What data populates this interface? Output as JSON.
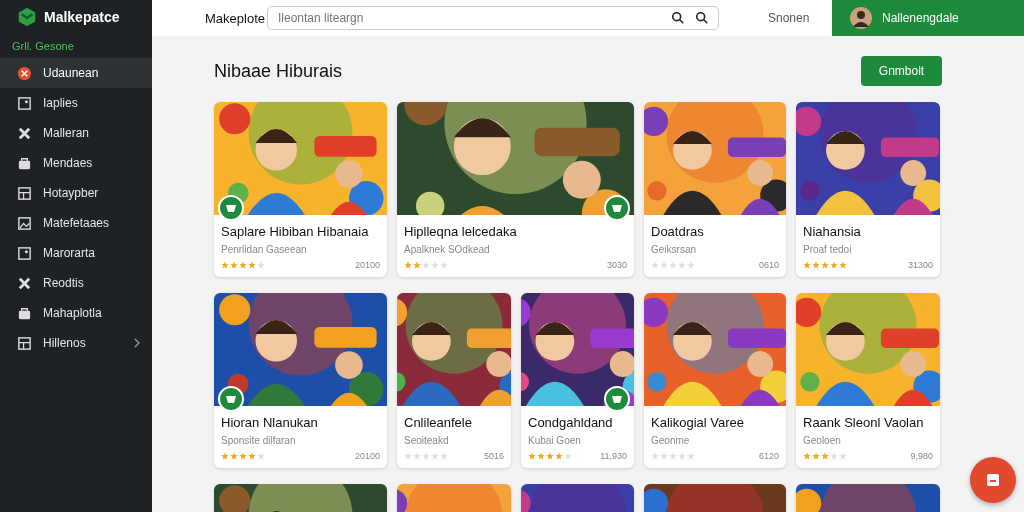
{
  "sidebar": {
    "logo": "Malkepatce",
    "section": "Grll. Gesone",
    "items": [
      {
        "label": "Udaunean",
        "selected": true,
        "has_submenu": false
      },
      {
        "label": "Iaplies",
        "selected": false,
        "has_submenu": false
      },
      {
        "label": "Malleran",
        "selected": false,
        "has_submenu": false
      },
      {
        "label": "Mendaes",
        "selected": false,
        "has_submenu": false
      },
      {
        "label": "Hotaypber",
        "selected": false,
        "has_submenu": false
      },
      {
        "label": "Matefetaaes",
        "selected": false,
        "has_submenu": false
      },
      {
        "label": "Marorarta",
        "selected": false,
        "has_submenu": false
      },
      {
        "label": "Reodtis",
        "selected": false,
        "has_submenu": false
      },
      {
        "label": "Mahaplotla",
        "selected": false,
        "has_submenu": false
      },
      {
        "label": "Hillenos",
        "selected": false,
        "has_submenu": true
      }
    ]
  },
  "topbar": {
    "brand": "Makeplote",
    "search": {
      "placeholder": "Ileontan liteargn"
    },
    "link": "Snonen",
    "user": "Nallenengdale"
  },
  "heading": "Nibaae Hiburais",
  "action_button": "Gnmbolt",
  "rows": [
    [
      {
        "kind": "card",
        "title": "Saplare Hibiban Hibanaia",
        "subtitle": "Penrlidan Gaseean",
        "stars": 4,
        "price": "20100",
        "badge_left": true,
        "badge_right": false
      },
      {
        "kind": "card",
        "title": "Hiplleqna lelcedaka",
        "subtitle": "Apalknek SOdkead",
        "stars": 2,
        "price": "3030",
        "badge_left": false,
        "badge_right": true
      },
      {
        "kind": "card",
        "title": "Doatdras",
        "subtitle": "Geiksrsan",
        "stars": 0,
        "price": "0610",
        "badge_left": false,
        "badge_right": false
      },
      {
        "kind": "card",
        "title": "Niahansia",
        "subtitle": "Proaf tedoi",
        "stars": 5,
        "price": "31300",
        "badge_left": false,
        "badge_right": false
      }
    ],
    [
      {
        "kind": "card",
        "title": "Hioran Nlanukan",
        "subtitle": "Sponsite dilfaran",
        "stars": 4,
        "price": "20100",
        "badge_left": true,
        "badge_right": false
      },
      {
        "kind": "card",
        "title": "Cnlileanfele",
        "subtitle": "Seoiteakd",
        "stars": 0,
        "price": "5016",
        "badge_left": false,
        "badge_right": false
      },
      {
        "kind": "card",
        "title": "Condgahldand",
        "subtitle": "Kubai Goen",
        "stars": 4,
        "price": "11,930",
        "badge_left": false,
        "badge_right": true
      },
      {
        "kind": "card",
        "title": "Kalikogial Varee",
        "subtitle": "Geonme",
        "stars": 0,
        "price": "6120",
        "badge_left": false,
        "badge_right": false
      },
      {
        "kind": "card",
        "title": "Raank Sleonl Vaolan",
        "subtitle": "Geoloen",
        "stars": 3,
        "price": "9,980",
        "badge_left": false,
        "badge_right": false
      }
    ],
    [
      {
        "kind": "picture"
      },
      {
        "kind": "picture"
      },
      {
        "kind": "picture"
      },
      {
        "kind": "picture"
      },
      {
        "kind": "picture"
      }
    ]
  ]
}
